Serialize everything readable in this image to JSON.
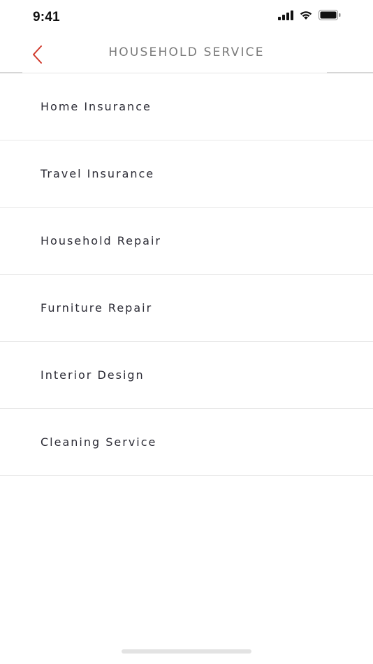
{
  "status_bar": {
    "time": "9:41",
    "icons": [
      "cellular-signal-icon",
      "wifi-icon",
      "battery-icon"
    ]
  },
  "nav": {
    "title": "HOUSEHOLD SERVICE",
    "back_icon": "chevron-left-icon",
    "accent_color": "#d0392b"
  },
  "services": [
    {
      "label": "Home Insurance"
    },
    {
      "label": "Travel Insurance"
    },
    {
      "label": "Household Repair"
    },
    {
      "label": "Furniture Repair"
    },
    {
      "label": "Interior Design"
    },
    {
      "label": "Cleaning Service"
    }
  ]
}
